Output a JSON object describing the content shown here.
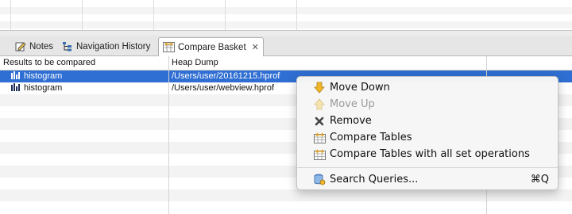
{
  "tabs": [
    {
      "label": "Notes",
      "icon": "notes-icon"
    },
    {
      "label": "Navigation History",
      "icon": "navigation-history-icon"
    },
    {
      "label": "Compare Basket",
      "icon": "compare-basket-icon",
      "active": true,
      "close": "close-tab-icon"
    }
  ],
  "table": {
    "columns": [
      "Results to be compared",
      "Heap Dump"
    ],
    "rows": [
      {
        "name": "histogram",
        "heap_dump": "/Users/user/20161215.hprof",
        "selected": true
      },
      {
        "name": "histogram",
        "heap_dump": "/Users/user/webview.hprof",
        "selected": false
      }
    ]
  },
  "context_menu": {
    "items": [
      {
        "label": "Move Down",
        "icon": "move-down-icon",
        "enabled": true
      },
      {
        "label": "Move Up",
        "icon": "move-up-icon",
        "enabled": false
      },
      {
        "label": "Remove",
        "icon": "remove-icon",
        "enabled": true
      },
      {
        "label": "Compare Tables",
        "icon": "compare-tables-icon",
        "enabled": true
      },
      {
        "label": "Compare Tables with all set operations",
        "icon": "compare-tables-set-ops-icon",
        "enabled": true
      },
      {
        "label": "Search Queries...",
        "icon": "search-queries-icon",
        "shortcut": "⌘Q",
        "enabled": true
      }
    ]
  },
  "colors": {
    "selection": "#2f6ed2",
    "row_alt": "#f3f3f3",
    "arrow_yellow": "#f0b828"
  }
}
